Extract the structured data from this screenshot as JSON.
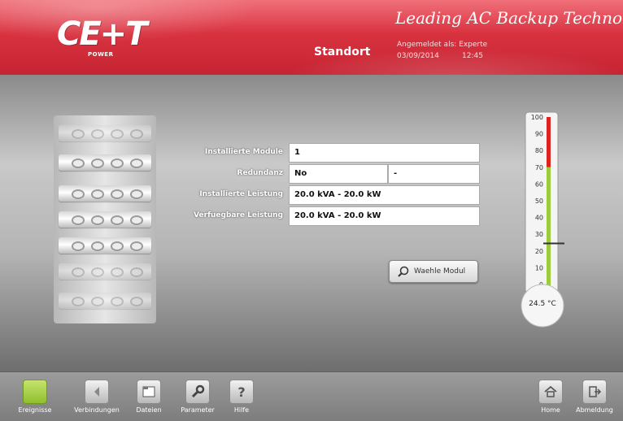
{
  "header": {
    "logo_text": "CE+T",
    "logo_sub": "POWER",
    "slogan": "Leading AC Backup Technology",
    "location": "Standort",
    "login_label": "Angemeldet als: Experte",
    "login_date": "03/09/2014",
    "login_time": "12:45",
    "color": "#d8323f"
  },
  "info": {
    "rows": [
      {
        "label": "Installierte Module",
        "value": "1"
      },
      {
        "label": "Redundanz",
        "value": "No",
        "extra": "-"
      },
      {
        "label": "Installierte Leistung",
        "value": "20.0 kVA - 20.0 kW"
      },
      {
        "label": "Verfuegbare Leistung",
        "value": "20.0 kVA - 20.0 kW"
      }
    ]
  },
  "select_button": {
    "label": "Waehle Modul",
    "icon": "search-icon"
  },
  "thermometer": {
    "scale": [
      "100",
      "90",
      "80",
      "70",
      "60",
      "50",
      "40",
      "30",
      "20",
      "10",
      "0"
    ],
    "value_c": 24.5,
    "readout": "24.5 °C",
    "red_from": 70,
    "colors": {
      "red": "#d22",
      "green": "#9ccb3c"
    }
  },
  "rack": {
    "slots_total": 7,
    "slots_highlighted": 5
  },
  "nav": {
    "left": [
      {
        "label": "Ereignisse",
        "icon": "events-icon",
        "active": true
      },
      {
        "label": "Verbindungen",
        "icon": "connections-icon"
      },
      {
        "label": "Dateien",
        "icon": "files-icon"
      },
      {
        "label": "Parameter",
        "icon": "wrench-icon"
      },
      {
        "label": "Hilfe",
        "icon": "help-icon"
      }
    ],
    "right": [
      {
        "label": "Home",
        "icon": "home-icon"
      },
      {
        "label": "Abmeldung",
        "icon": "logout-icon"
      }
    ]
  }
}
